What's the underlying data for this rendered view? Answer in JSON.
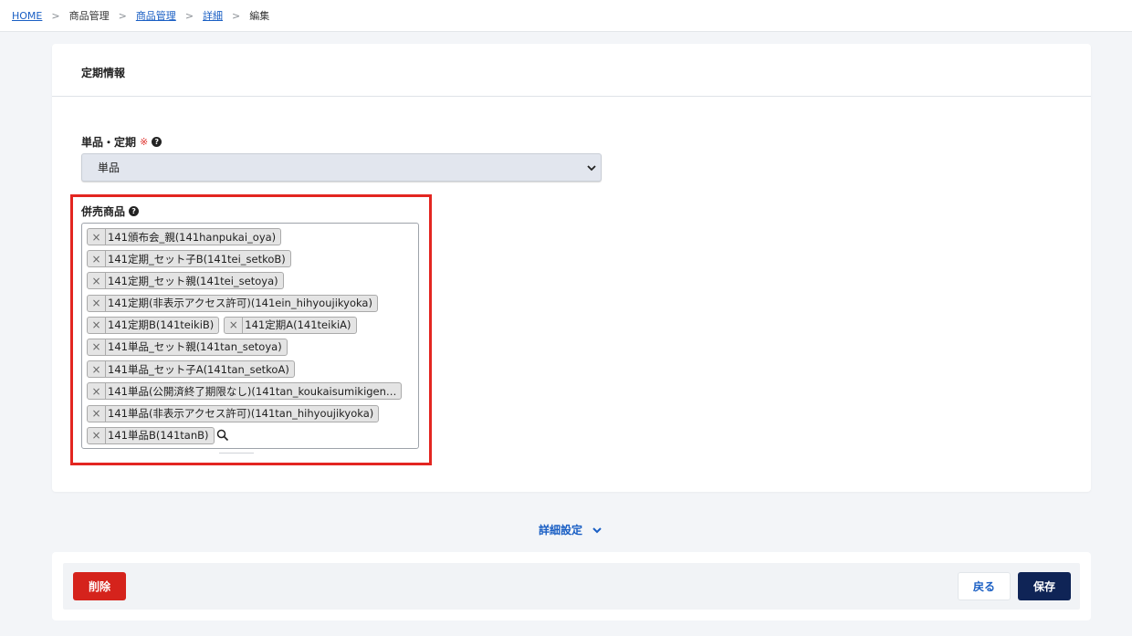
{
  "breadcrumb": {
    "home": "HOME",
    "item1": "商品管理",
    "item2": "商品管理",
    "item3": "詳細",
    "item4": "編集",
    "separator": ">"
  },
  "section": {
    "title": "定期情報"
  },
  "type_field": {
    "label": "単品・定期",
    "required_mark": "※",
    "help_icon": "question-circle-icon",
    "selected_value": "単品"
  },
  "related_products": {
    "label": "併売商品",
    "help_icon": "question-circle-icon",
    "rows": [
      [
        {
          "text": "141頒布会_親(141hanpukai_oya)"
        }
      ],
      [
        {
          "text": "141定期_セット子B(141tei_setkoB)"
        }
      ],
      [
        {
          "text": "141定期_セット親(141tei_setoya)"
        }
      ],
      [
        {
          "text": "141定期(非表示アクセス許可)(141ein_hihyoujikyoka)"
        }
      ],
      [
        {
          "text": "141定期B(141teikiB)"
        },
        {
          "text": "141定期A(141teikiA)"
        }
      ],
      [
        {
          "text": "141単品_セット親(141tan_setoya)"
        }
      ],
      [
        {
          "text": "141単品_セット子A(141tan_setkoA)"
        }
      ],
      [
        {
          "text": "141単品(公開済終了期限なし)(141tan_koukaisumikigen…"
        }
      ],
      [
        {
          "text": "141単品(非表示アクセス許可)(141tan_hihyoujikyoka)"
        }
      ],
      [
        {
          "text": "141単品B(141tanB)"
        }
      ]
    ],
    "remove_glyph": "×"
  },
  "detail_toggle": {
    "label": "詳細設定"
  },
  "footer": {
    "delete_label": "削除",
    "back_label": "戻る",
    "save_label": "保存"
  },
  "colors": {
    "accent": "#1a5fc4",
    "danger": "#d5231c",
    "primary_dark": "#0f2456",
    "highlight": "#e32621"
  }
}
